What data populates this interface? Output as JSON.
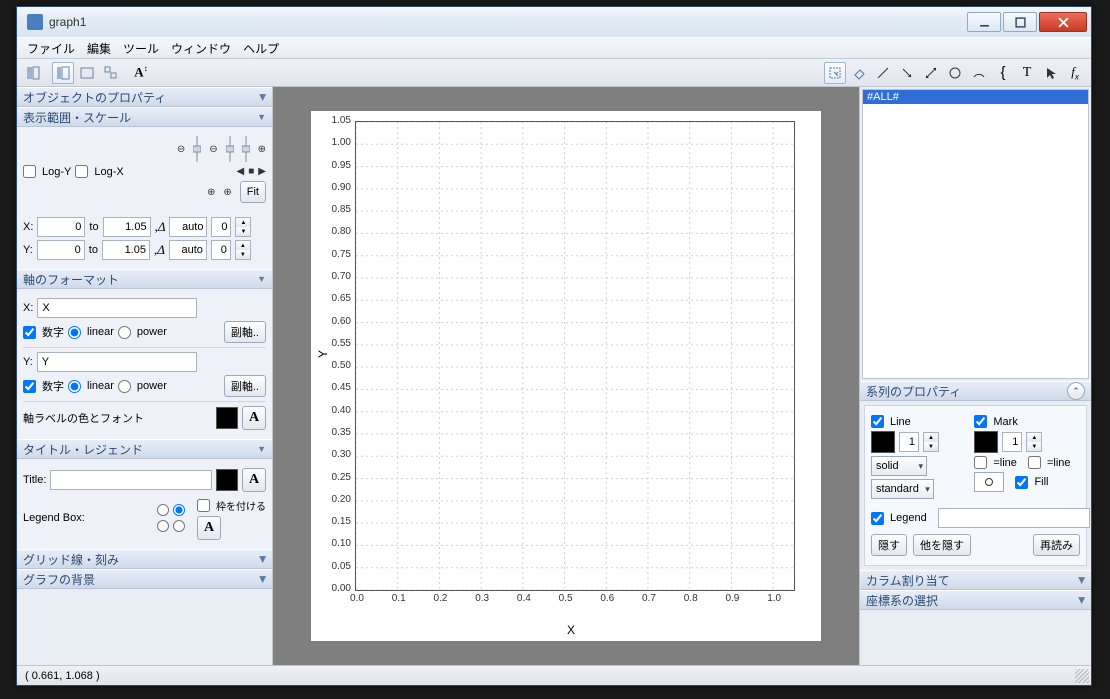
{
  "window": {
    "title": "graph1"
  },
  "menu": [
    "ファイル",
    "編集",
    "ツール",
    "ウィンドウ",
    "ヘルプ"
  ],
  "left": {
    "hdr_object": "オブジェクトのプロパティ",
    "hdr_scale": "表示範囲・スケール",
    "logY": "Log-Y",
    "logX": "Log-X",
    "fit": "Fit",
    "x": "X:",
    "y": "Y:",
    "to": "to",
    "xfrom": "0",
    "xto": "1.05",
    "auto": "auto",
    "zero": "0",
    "yfrom": "0",
    "yto": "1.05",
    "hdr_axis": "軸のフォーマット",
    "xlabelField": "X",
    "ylabelField": "Y",
    "numLabel": "数字",
    "linear": "linear",
    "power": "power",
    "subaxis": "副軸..",
    "axisColor": "軸ラベルの色とフォント",
    "hdr_title": "タイトル・レジェンド",
    "titleLabel": "Title:",
    "legendBox": "Legend Box:",
    "frame": "枠を付ける",
    "hdr_grid": "グリッド線・刻み",
    "hdr_bg": "グラフの背景"
  },
  "right": {
    "all": "#ALL#",
    "hdr_series": "系列のプロパティ",
    "line": "Line",
    "mark": "Mark",
    "one": "1",
    "solid": "solid",
    "standard": "standard",
    "eqline": "=line",
    "fill": "Fill",
    "legend": "Legend",
    "hide": "隠す",
    "hideOthers": "他を隠す",
    "reload": "再読み",
    "hdr_column": "カラム割り当て",
    "hdr_coord": "座標系の選択"
  },
  "status": "( 0.661,   1.068 )",
  "chart_data": {
    "type": "scatter",
    "series": [],
    "xlabel": "X",
    "ylabel": "Y",
    "xlim": [
      0,
      1.05
    ],
    "ylim": [
      0,
      1.05
    ],
    "xticks": [
      0.0,
      0.1,
      0.2,
      0.3,
      0.4,
      0.5,
      0.6,
      0.7,
      0.8,
      0.9,
      1.0
    ],
    "yticks": [
      0.0,
      0.05,
      0.1,
      0.15,
      0.2,
      0.25,
      0.3,
      0.35,
      0.4,
      0.45,
      0.5,
      0.55,
      0.6,
      0.65,
      0.7,
      0.75,
      0.8,
      0.85,
      0.9,
      0.95,
      1.0,
      1.05
    ]
  }
}
